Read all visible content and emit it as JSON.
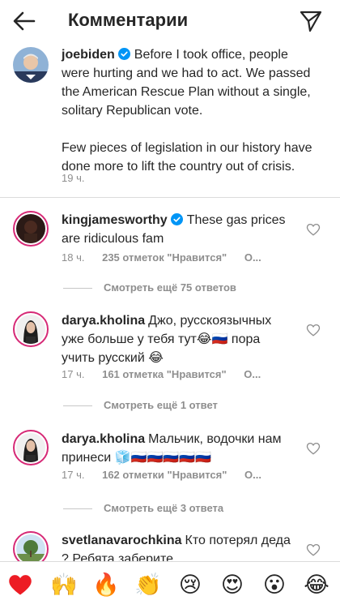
{
  "header": {
    "title": "Комментарии"
  },
  "caption": {
    "username": "joebiden",
    "paragraph1": "Before I took office, people were hurting and we had to act. We passed the American Rescue Plan without a single, solitary Republican vote.",
    "paragraph2": "Few pieces of legislation in our history have done more to lift the country out of crisis.",
    "time": "19 ч."
  },
  "comments": [
    {
      "username": "kingjamesworthy",
      "text": "These gas prices are ridiculous fam",
      "time": "18 ч.",
      "likes": "235 отметок \"Нравится\"",
      "reply": "О...",
      "view_replies": "Смотреть ещё 75 ответов"
    },
    {
      "username": "darya.kholina",
      "text": "Джо, русскоязычных уже больше у тебя тут😂🇷🇺 пора учить русский 😂",
      "time": "17 ч.",
      "likes": "161 отметка \"Нравится\"",
      "reply": "О...",
      "view_replies": "Смотреть ещё 1 ответ"
    },
    {
      "username": "darya.kholina",
      "text": "Мальчик, водочки нам принеси 🧊🇷🇺🇷🇺🇷🇺🇷🇺🇷🇺",
      "time": "17 ч.",
      "likes": "162 отметки \"Нравится\"",
      "reply": "О...",
      "view_replies": "Смотреть ещё 3 ответа"
    },
    {
      "username": "svetlanavarochkina",
      "text": "Кто потерял деда ? Ребята заберите"
    }
  ],
  "emoji_bar": [
    "❤️",
    "🙌",
    "🔥",
    "👏",
    "😢",
    "😍",
    "😮",
    "😂"
  ],
  "colors": {
    "accent_blue": "#0095f6",
    "heart_red": "#ed4956",
    "meta_gray": "#8e8e8e"
  }
}
